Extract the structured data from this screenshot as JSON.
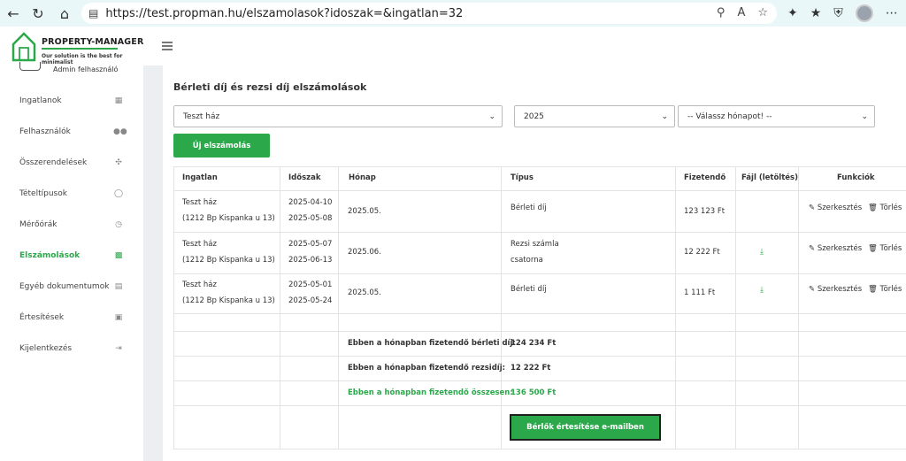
{
  "browser": {
    "url": "https://test.propman.hu/elszamolasok?idoszak=&ingatlan=32"
  },
  "logo": {
    "title": "PROPERTY-MANAGER",
    "subtitle": "Our solution is the best for minimalist"
  },
  "sidebar": {
    "user": "Admin felhasználó",
    "items": [
      {
        "label": "Ingatlanok",
        "icon": "buildings-icon"
      },
      {
        "label": "Felhasználók",
        "icon": "users-icon"
      },
      {
        "label": "Összerendelések",
        "icon": "network-icon"
      },
      {
        "label": "Tételtípusok",
        "icon": "database-icon"
      },
      {
        "label": "Mérőórák",
        "icon": "clock-icon"
      },
      {
        "label": "Elszámolások",
        "icon": "money-icon"
      },
      {
        "label": "Egyéb dokumentumok",
        "icon": "documents-icon"
      },
      {
        "label": "Értesítések",
        "icon": "calendar-icon"
      },
      {
        "label": "Kijelentkezés",
        "icon": "logout-icon"
      }
    ],
    "active_index": 5
  },
  "main": {
    "title": "Bérleti díj és rezsi díj elszámolások",
    "filters": {
      "property": "Teszt ház",
      "year": "2025",
      "month": "-- Válassz hónapot! --"
    },
    "new_button": "Új elszámolás",
    "table": {
      "headers": [
        "Ingatlan",
        "Időszak",
        "Hónap",
        "Típus",
        "Fizetendő",
        "Fájl (letöltés)",
        "Funkciók"
      ],
      "rows": [
        {
          "property": "Teszt ház",
          "address": "(1212 Bp Kispanka u 13)",
          "from": "2025-04-10",
          "to": "2025-05-08",
          "month": "2025.05.",
          "type": "Bérleti díj",
          "type2": "",
          "amount": "123 123 Ft",
          "file": false
        },
        {
          "property": "Teszt ház",
          "address": "(1212 Bp Kispanka u 13)",
          "from": "2025-05-07",
          "to": "2025-06-13",
          "month": "2025.06.",
          "type": "Rezsi számla",
          "type2": "csatorna",
          "amount": "12 222 Ft",
          "file": true
        },
        {
          "property": "Teszt ház",
          "address": "(1212 Bp Kispanka u 13)",
          "from": "2025-05-01",
          "to": "2025-05-24",
          "month": "2025.05.",
          "type": "Bérleti díj",
          "type2": "",
          "amount": "1 111 Ft",
          "file": true
        }
      ],
      "edit_label": "Szerkesztés",
      "delete_label": "Törlés"
    },
    "summary": {
      "rent_label": "Ebben a hónapban fizetendő bérleti díj:",
      "rent_value": "124 234 Ft",
      "utility_label": "Ebben a hónapban fizetendő rezsidíj:",
      "utility_value": "12 222 Ft",
      "total_label": "Ebben a hónapban fizetendő összesen:",
      "total_value": "136 500 Ft"
    },
    "notify_button": "Bérlők értesítése e-mailben"
  },
  "colors": {
    "accent": "#2aa84a",
    "browser_bar": "#e9f7f8"
  }
}
